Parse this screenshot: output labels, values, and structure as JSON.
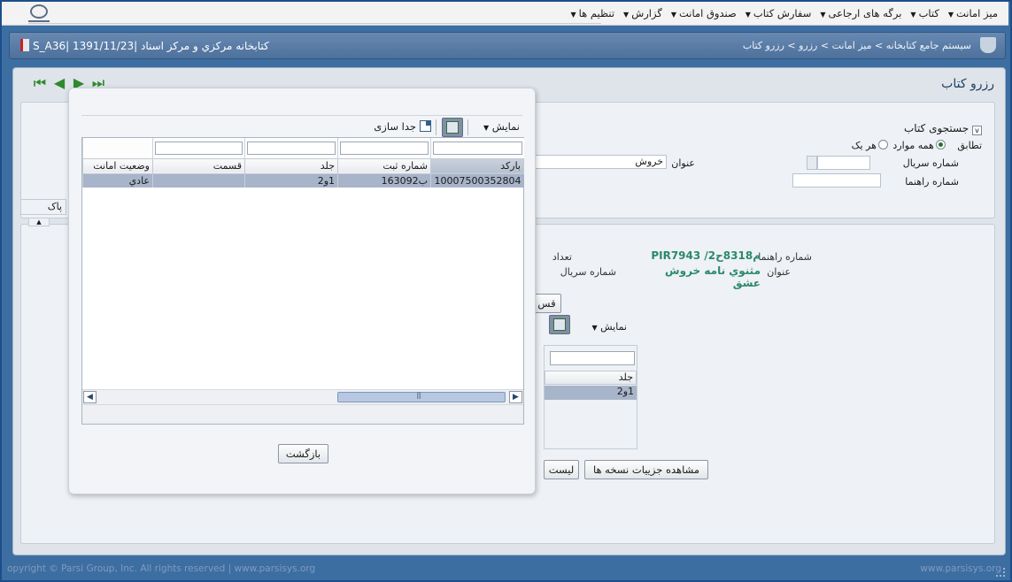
{
  "menubar": {
    "items": [
      {
        "label": "میز امانت"
      },
      {
        "label": "کتاب"
      },
      {
        "label": "برگه های ارجاعی"
      },
      {
        "label": "سفارش کتاب"
      },
      {
        "label": "صندوق امانت"
      },
      {
        "label": "گزارش"
      },
      {
        "label": "تنظیم ها"
      }
    ]
  },
  "header": {
    "breadcrumb": "سیستم جامع کتابخانه > میز امانت > رزرو > رزرو کتاب",
    "user_info": "S_A36| کتابخانه مرکزي و مرکز اسناد |1391/11/23"
  },
  "main": {
    "page_title": "رزرو کتاب",
    "search": {
      "title": "جستجوی کتاب",
      "match_label": "تطابق",
      "match_all": "همه موارد",
      "match_any": "هر یک",
      "serial_label": "شماره سریال",
      "title_label": "عنوان",
      "title_value": "خروش",
      "call_label": "شماره راهنما",
      "clear_label": "پاک کردن"
    },
    "details": {
      "call_label": "شماره راهنما",
      "call_value": "PIR7943 /م8318ح2",
      "title_label": "عنوان",
      "title_value_line1": "مثنوي نامه خروش",
      "title_value_line2": "عشق",
      "count_label": "تعداد",
      "serial_label": "شماره سریال",
      "section_btn": "قس",
      "show_menu": "نمایش",
      "grid_col": "جلد",
      "grid_val": "1و2"
    },
    "list_btn": "لیست",
    "view_copies_btn": "مشاهده جزییات نسخه ها"
  },
  "modal": {
    "show_menu": "نمایش",
    "detach": "جدا سازی",
    "columns": [
      "بارکد",
      "شماره ثبت",
      "جلد",
      "قسمت",
      "وضعیت امانت"
    ],
    "rows": [
      {
        "barcode": "10007500352804",
        "reg_no": "ب163092",
        "volume": "1و2",
        "part": "",
        "status": "عادي"
      }
    ],
    "back_button": "بازگشت"
  },
  "footer": {
    "copyright": "opyright © Parsi Group, Inc. All rights reserved | www.parsisys.org",
    "site": "www.parsisys.org"
  }
}
